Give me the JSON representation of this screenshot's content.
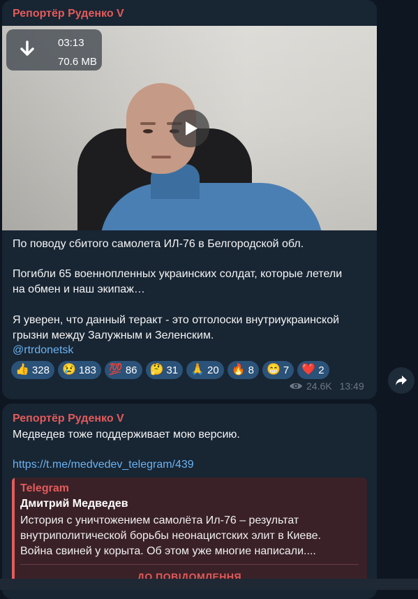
{
  "message1": {
    "sender": "Репортёр Руденко V",
    "video": {
      "duration": "03:13",
      "size": "70.6 MB"
    },
    "text": {
      "line1": "По поводу сбитого самолета ИЛ-76 в Белгородской обл.",
      "line2": "Погибли 65 военнопленных украинских солдат, которые летели",
      "line3": "на обмен и наш экипаж…",
      "line4": "Я уверен, что данный теракт - это отголоски внутриукраинской",
      "line5": "грызни между Залужным и Зеленским.",
      "mention": "@rtrdonetsk"
    },
    "reactions": [
      {
        "emoji": "👍",
        "count": "328"
      },
      {
        "emoji": "😢",
        "count": "183"
      },
      {
        "emoji": "💯",
        "count": "86"
      },
      {
        "emoji": "🤔",
        "count": "31"
      },
      {
        "emoji": "🙏",
        "count": "20"
      },
      {
        "emoji": "🔥",
        "count": "8"
      },
      {
        "emoji": "😁",
        "count": "7"
      },
      {
        "emoji": "❤️",
        "count": "2"
      }
    ],
    "views": "24.6K",
    "time": "13:49"
  },
  "message2": {
    "sender": "Репортёр Руденко V",
    "text": "Медведев тоже поддерживает мою версию.",
    "link": "https://t.me/medvedev_telegram/439",
    "preview": {
      "site": "Telegram",
      "title": "Дмитрий Медведев",
      "desc_line1": "История с уничтожением самолёта Ил-76 – результат",
      "desc_line2": "внутриполитической борьбы неонацистских элит в Киеве.",
      "desc_line3": "Война свиней у корыта. Об этом уже многие написали....",
      "button": "ДО ПОВІДОМЛЕННЯ"
    }
  },
  "icons": {
    "download": "download-icon",
    "play": "play-icon",
    "views": "eye-icon",
    "share": "share-arrow-icon"
  },
  "colors": {
    "background": "#0e1621",
    "bubble": "#182533",
    "sender": "#e35b5b",
    "link": "#6ab3f3",
    "reaction_chip": "#2b5278",
    "meta": "#6c7883"
  }
}
